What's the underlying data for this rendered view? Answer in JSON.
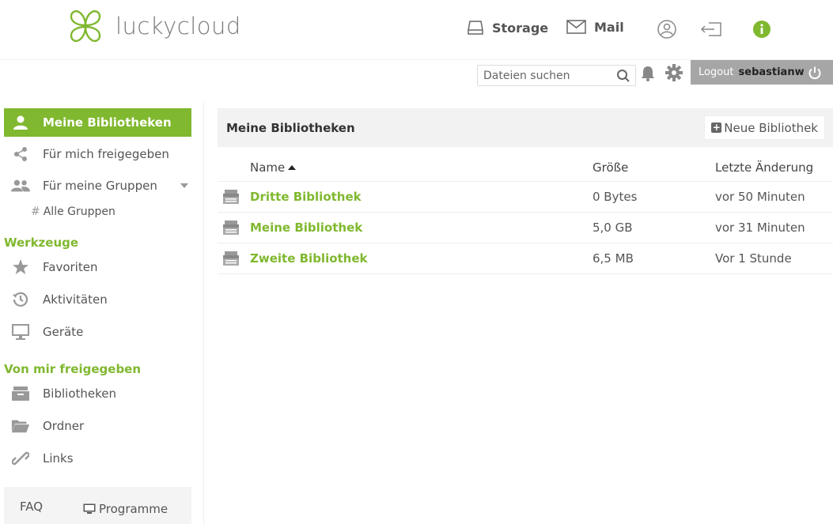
{
  "brand": {
    "name": "luckycloud",
    "color": "#80b82f"
  },
  "topnav": {
    "storage_label": "Storage",
    "mail_label": "Mail",
    "icons": [
      "user-circle-icon",
      "logout-arrow-icon",
      "info-icon"
    ]
  },
  "toolbar": {
    "search_placeholder": "Dateien suchen",
    "logout_label": "Logout",
    "username": "sebastianw"
  },
  "sidebar": {
    "items": [
      {
        "label": "Meine Bibliotheken",
        "icon": "user-icon",
        "active": true
      },
      {
        "label": "Für mich freigegeben",
        "icon": "share-icon"
      },
      {
        "label": "Für meine Gruppen",
        "icon": "group-icon"
      }
    ],
    "groups_sub": {
      "hash": "#",
      "label": "Alle Gruppen"
    },
    "tools_heading": "Werkzeuge",
    "tools": [
      {
        "label": "Favoriten",
        "icon": "star-icon"
      },
      {
        "label": "Aktivitäten",
        "icon": "history-icon"
      },
      {
        "label": "Geräte",
        "icon": "monitor-icon"
      }
    ],
    "shared_heading": "Von mir freigegeben",
    "shared": [
      {
        "label": "Bibliotheken",
        "icon": "library-icon"
      },
      {
        "label": "Ordner",
        "icon": "folder-icon"
      },
      {
        "label": "Links",
        "icon": "link-icon"
      }
    ],
    "footer": {
      "faq": "FAQ",
      "programs": "Programme"
    }
  },
  "main": {
    "title": "Meine Bibliotheken",
    "new_button": "Neue Bibliothek",
    "columns": {
      "name": "Name",
      "size": "Größe",
      "modified": "Letzte Änderung"
    },
    "rows": [
      {
        "name": "Dritte Bibliothek",
        "size": "0 Bytes",
        "modified": "vor 50 Minuten"
      },
      {
        "name": "Meine Bibliothek",
        "size": "5,0 GB",
        "modified": "vor 31 Minuten"
      },
      {
        "name": "Zweite Bibliothek",
        "size": "6,5 MB",
        "modified": "Vor 1 Stunde"
      }
    ]
  }
}
